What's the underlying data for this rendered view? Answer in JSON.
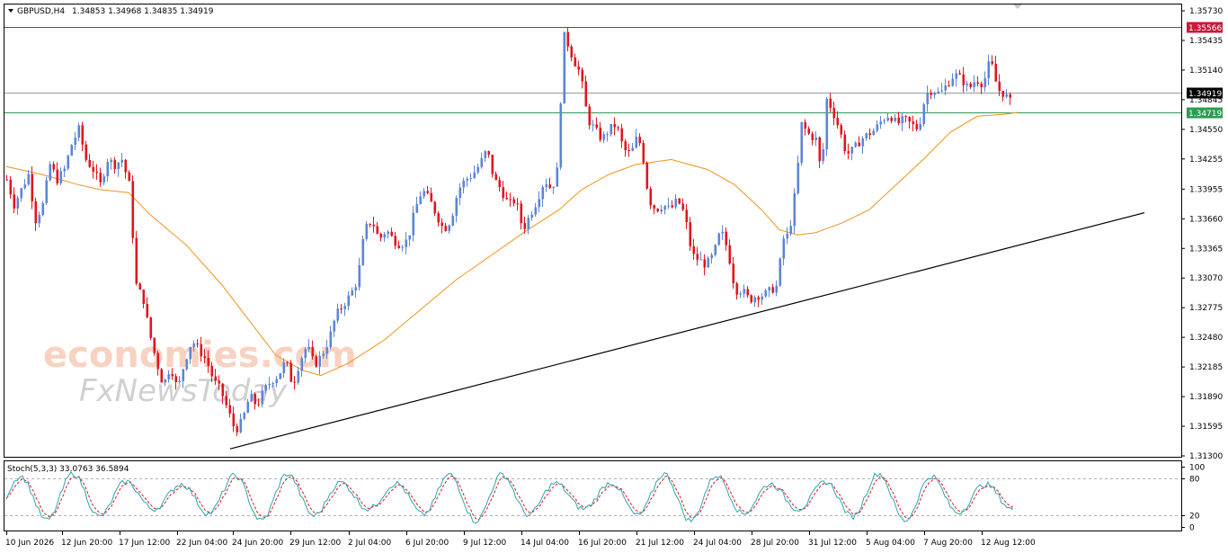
{
  "header": {
    "symbol": "GBPUSD,H4",
    "ohlc": "1.34853 1.34968 1.34835 1.34919"
  },
  "stoch_header": "Stoch(5,3,3) 33.0763 36.5894",
  "colors": {
    "bull": "#5b86d6",
    "bear": "#e0151e",
    "ma": "#f0921c",
    "resistance_line": "#c8193b",
    "support_line": "#2e9a53",
    "price_line": "#9a9a9a",
    "trendline": "#000000",
    "stoch_main": "#2ea3b2",
    "stoch_signal": "#e0151e"
  },
  "watermark": {
    "line1": "economies.com",
    "line2": "FxNewsToday"
  },
  "chart_data": [
    {
      "type": "candlestick",
      "title": "GBPUSD,H4",
      "ylim": [
        1.313,
        1.3573
      ],
      "y_ticks": [
        "1.35730",
        "1.35435",
        "1.35140",
        "1.34845",
        "1.34550",
        "1.34255",
        "1.33955",
        "1.33660",
        "1.33365",
        "1.33070",
        "1.32775",
        "1.32480",
        "1.32185",
        "1.31890",
        "1.31595",
        "1.31300"
      ],
      "x_ticks": [
        "10 Jun 2026",
        "12 Jun 20:00",
        "17 Jun 12:00",
        "22 Jun 04:00",
        "24 Jun 20:00",
        "29 Jun 12:00",
        "2 Jul 04:00",
        "6 Jul 20:00",
        "9 Jul 12:00",
        "14 Jul 04:00",
        "16 Jul 20:00",
        "21 Jul 12:00",
        "24 Jul 04:00",
        "28 Jul 20:00",
        "31 Jul 12:00",
        "5 Aug 04:00",
        "7 Aug 20:00",
        "12 Aug 12:00"
      ],
      "price_markers": [
        {
          "label": "1.35566",
          "value": 1.35566,
          "role": "resistance"
        },
        {
          "label": "1.34919",
          "value": 1.34919,
          "role": "last"
        },
        {
          "label": "1.34719",
          "value": 1.34719,
          "role": "support"
        }
      ],
      "close_path": [
        [
          0,
          1.3405
        ],
        [
          8,
          1.338
        ],
        [
          16,
          1.3395
        ],
        [
          24,
          1.341
        ],
        [
          32,
          1.3365
        ],
        [
          40,
          1.338
        ],
        [
          48,
          1.342
        ],
        [
          56,
          1.3405
        ],
        [
          64,
          1.3415
        ],
        [
          72,
          1.344
        ],
        [
          80,
          1.3455
        ],
        [
          88,
          1.3425
        ],
        [
          96,
          1.3415
        ],
        [
          104,
          1.34
        ],
        [
          112,
          1.3425
        ],
        [
          120,
          1.342
        ],
        [
          128,
          1.3425
        ],
        [
          136,
          1.34
        ],
        [
          144,
          1.33
        ],
        [
          152,
          1.3285
        ],
        [
          158,
          1.3255
        ],
        [
          166,
          1.3225
        ],
        [
          174,
          1.32
        ],
        [
          182,
          1.322
        ],
        [
          190,
          1.3195
        ],
        [
          198,
          1.3225
        ],
        [
          206,
          1.3245
        ],
        [
          214,
          1.3235
        ],
        [
          222,
          1.3225
        ],
        [
          230,
          1.3205
        ],
        [
          238,
          1.3195
        ],
        [
          246,
          1.3175
        ],
        [
          254,
          1.3155
        ],
        [
          262,
          1.3165
        ],
        [
          270,
          1.319
        ],
        [
          278,
          1.318
        ],
        [
          286,
          1.3195
        ],
        [
          294,
          1.3205
        ],
        [
          302,
          1.321
        ],
        [
          310,
          1.3225
        ],
        [
          318,
          1.32
        ],
        [
          326,
          1.3225
        ],
        [
          334,
          1.324
        ],
        [
          342,
          1.322
        ],
        [
          350,
          1.323
        ],
        [
          358,
          1.3245
        ],
        [
          366,
          1.327
        ],
        [
          374,
          1.328
        ],
        [
          382,
          1.329
        ],
        [
          390,
          1.3305
        ],
        [
          398,
          1.3355
        ],
        [
          406,
          1.3365
        ],
        [
          414,
          1.3345
        ],
        [
          422,
          1.3355
        ],
        [
          430,
          1.3345
        ],
        [
          438,
          1.334
        ],
        [
          446,
          1.3345
        ],
        [
          454,
          1.3375
        ],
        [
          462,
          1.3395
        ],
        [
          470,
          1.3385
        ],
        [
          478,
          1.337
        ],
        [
          486,
          1.3355
        ],
        [
          494,
          1.3365
        ],
        [
          502,
          1.3395
        ],
        [
          510,
          1.3405
        ],
        [
          518,
          1.341
        ],
        [
          526,
          1.342
        ],
        [
          534,
          1.3435
        ],
        [
          542,
          1.3405
        ],
        [
          550,
          1.3395
        ],
        [
          558,
          1.338
        ],
        [
          566,
          1.3385
        ],
        [
          574,
          1.3355
        ],
        [
          582,
          1.337
        ],
        [
          590,
          1.3385
        ],
        [
          598,
          1.3405
        ],
        [
          606,
          1.3395
        ],
        [
          614,
          1.342
        ],
        [
          618,
          1.355
        ],
        [
          622,
          1.3545
        ],
        [
          630,
          1.3525
        ],
        [
          638,
          1.351
        ],
        [
          646,
          1.3465
        ],
        [
          654,
          1.3455
        ],
        [
          662,
          1.3445
        ],
        [
          670,
          1.3455
        ],
        [
          678,
          1.346
        ],
        [
          686,
          1.3435
        ],
        [
          694,
          1.343
        ],
        [
          702,
          1.345
        ],
        [
          708,
          1.3425
        ],
        [
          714,
          1.3385
        ],
        [
          722,
          1.3375
        ],
        [
          730,
          1.338
        ],
        [
          738,
          1.3375
        ],
        [
          746,
          1.3385
        ],
        [
          754,
          1.337
        ],
        [
          762,
          1.333
        ],
        [
          770,
          1.3325
        ],
        [
          778,
          1.332
        ],
        [
          786,
          1.333
        ],
        [
          794,
          1.3355
        ],
        [
          802,
          1.3335
        ],
        [
          810,
          1.3295
        ],
        [
          818,
          1.3295
        ],
        [
          826,
          1.3285
        ],
        [
          834,
          1.329
        ],
        [
          842,
          1.329
        ],
        [
          850,
          1.3295
        ],
        [
          858,
          1.33
        ],
        [
          862,
          1.3345
        ],
        [
          870,
          1.335
        ],
        [
          878,
          1.34
        ],
        [
          884,
          1.346
        ],
        [
          892,
          1.345
        ],
        [
          900,
          1.3445
        ],
        [
          906,
          1.341
        ],
        [
          912,
          1.3485
        ],
        [
          918,
          1.3475
        ],
        [
          926,
          1.3455
        ],
        [
          934,
          1.343
        ],
        [
          942,
          1.3435
        ],
        [
          950,
          1.3445
        ],
        [
          958,
          1.345
        ],
        [
          966,
          1.3455
        ],
        [
          974,
          1.3465
        ],
        [
          982,
          1.347
        ],
        [
          990,
          1.346
        ],
        [
          998,
          1.3465
        ],
        [
          1006,
          1.346
        ],
        [
          1014,
          1.3455
        ],
        [
          1022,
          1.349
        ],
        [
          1030,
          1.3495
        ],
        [
          1038,
          1.349
        ],
        [
          1046,
          1.35
        ],
        [
          1054,
          1.351
        ],
        [
          1062,
          1.3505
        ],
        [
          1070,
          1.3495
        ],
        [
          1078,
          1.3505
        ],
        [
          1086,
          1.35
        ],
        [
          1094,
          1.3525
        ],
        [
          1102,
          1.3495
        ],
        [
          1110,
          1.349
        ],
        [
          1118,
          1.348
        ],
        [
          1126,
          1.3492
        ]
      ],
      "ma_path": [
        [
          0,
          1.3418
        ],
        [
          40,
          1.341
        ],
        [
          80,
          1.34
        ],
        [
          104,
          1.3395
        ],
        [
          136,
          1.3392
        ],
        [
          160,
          1.337
        ],
        [
          200,
          1.334
        ],
        [
          240,
          1.33
        ],
        [
          270,
          1.3265
        ],
        [
          300,
          1.323
        ],
        [
          330,
          1.3215
        ],
        [
          350,
          1.321
        ],
        [
          380,
          1.3222
        ],
        [
          420,
          1.3245
        ],
        [
          460,
          1.3275
        ],
        [
          500,
          1.3305
        ],
        [
          540,
          1.333
        ],
        [
          580,
          1.3355
        ],
        [
          615,
          1.3375
        ],
        [
          640,
          1.3395
        ],
        [
          670,
          1.341
        ],
        [
          700,
          1.342
        ],
        [
          740,
          1.3425
        ],
        [
          780,
          1.3415
        ],
        [
          810,
          1.34
        ],
        [
          840,
          1.3375
        ],
        [
          860,
          1.3355
        ],
        [
          880,
          1.335
        ],
        [
          900,
          1.3352
        ],
        [
          930,
          1.3362
        ],
        [
          960,
          1.3375
        ],
        [
          990,
          1.34
        ],
        [
          1020,
          1.3425
        ],
        [
          1050,
          1.3452
        ],
        [
          1080,
          1.3468
        ],
        [
          1110,
          1.347
        ],
        [
          1126,
          1.3472
        ]
      ],
      "trendline": {
        "start": [
          1.3137,
          "24 Jun"
        ],
        "end": [
          1.3372,
          "rightmost"
        ]
      },
      "stochastic": {
        "ylim": [
          0,
          100
        ],
        "y_ticks": [
          "100",
          "80",
          "20",
          "0"
        ],
        "main": 33.0763,
        "signal": 36.5894
      }
    }
  ]
}
